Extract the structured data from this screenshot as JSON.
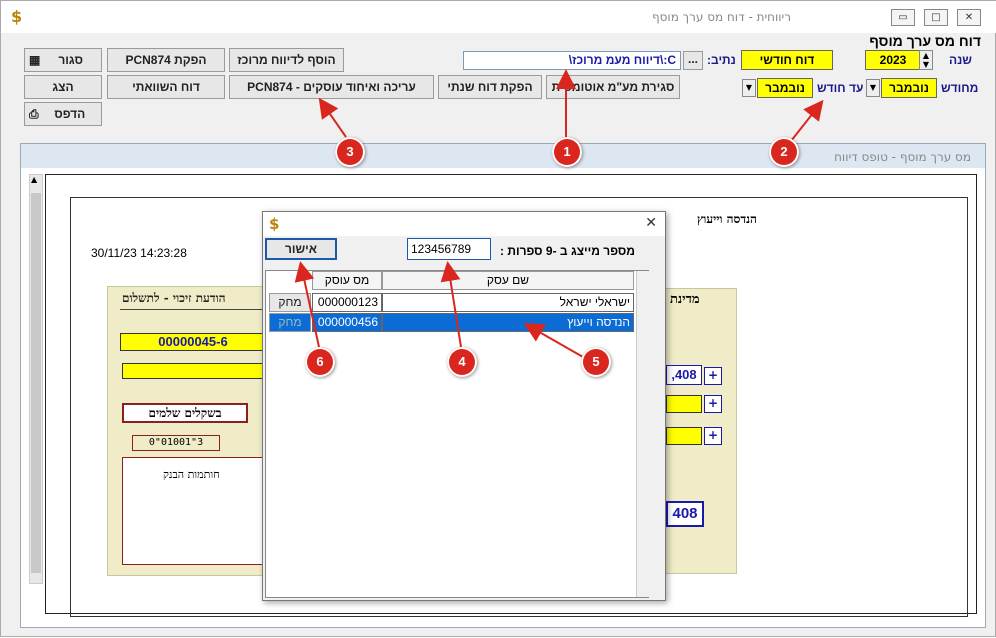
{
  "window": {
    "title": "ריווחית - דוח מס ערך מוסף",
    "icon": "dollar-icon",
    "min": "▭",
    "max": "□",
    "close": "✕"
  },
  "header": {
    "section_title": "דוח מס ערך מוסף",
    "year_label": "שנה",
    "year_value": "2023",
    "report_type": "דוח חודשי",
    "path_label": "נתיב:",
    "path_value": "C:\\דיווח מעמ מרוכז\\",
    "browse": "...",
    "from_month_label": "מחודש",
    "from_month_value": "נובמבר",
    "to_month_label": "עד חודש",
    "to_month_value": "נובמבר"
  },
  "toolbar": {
    "close": "סגור",
    "pcn874": "הפקת PCN874",
    "add_central": "הוסף לדיווח מרוכז",
    "show": "הצג",
    "compare": "דוח השוואתי",
    "edit_merge": "עריכה ואיחוד עוסקים - PCN874",
    "annual": "הפקת דוח שנתי",
    "auto_close": "סגירת מע\"מ אוטומטית",
    "print": "הדפס"
  },
  "panel": {
    "title": "מס ערך מוסף - טופס דיווח",
    "company": "הנדסה וייעוץ",
    "datetime": "30/11/23 14:23:28"
  },
  "form": {
    "left_title": "הודעת זיכוי - לתשלום",
    "left_number": "00000045-6",
    "left_currency": "בשקלים שלמים",
    "left_bank": "חותמות הבנק",
    "left_ref": "0\"01001\"3",
    "right_title": "מדינת",
    "right_value1": ",408",
    "right_value2": "408",
    "plus": "+"
  },
  "dialog": {
    "icon": "dollar-icon",
    "close": "✕",
    "id_label": "מספר מייצג ב -9 ספרות :",
    "id_value": "123456789",
    "confirm": "אישור",
    "columns": [
      "שם עסק",
      "מס עוסק"
    ],
    "rows": [
      {
        "name": "ישראלי ישראל",
        "id": "000000123",
        "action": "מחק"
      },
      {
        "name": "הנדסה וייעוץ",
        "id": "000000456",
        "action": "מחק"
      }
    ]
  },
  "markers": [
    "1",
    "2",
    "3",
    "4",
    "5",
    "6"
  ],
  "colors": {
    "accent": "#d9271f",
    "highlight": "#ffff00",
    "selection": "#0a6cd4"
  }
}
